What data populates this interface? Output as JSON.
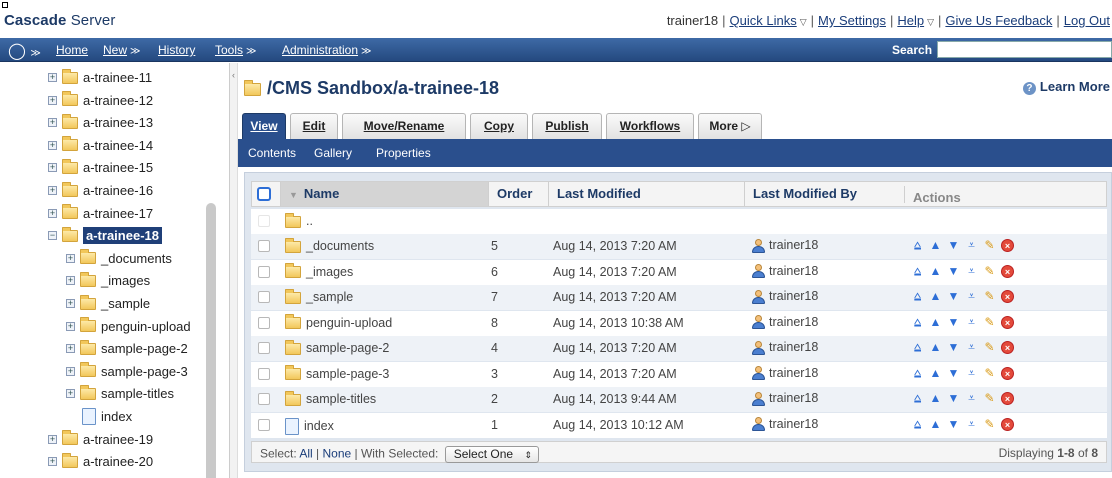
{
  "brand": {
    "name_bold": "Cascade",
    "name_rest": " Server"
  },
  "toplinks": {
    "user": "trainer18",
    "quick_links": "Quick Links",
    "my_settings": "My Settings",
    "help": "Help",
    "feedback": "Give Us Feedback",
    "logout": "Log Out"
  },
  "nav": {
    "items": [
      "Home",
      "New",
      "History",
      "Tools",
      "Administration"
    ],
    "search_label": "Search",
    "search_value": ""
  },
  "tree": [
    {
      "label": "a-trainee-11",
      "type": "folder",
      "expander": "+"
    },
    {
      "label": "a-trainee-12",
      "type": "folder",
      "expander": "+"
    },
    {
      "label": "a-trainee-13",
      "type": "folder",
      "expander": "+"
    },
    {
      "label": "a-trainee-14",
      "type": "folder",
      "expander": "+"
    },
    {
      "label": "a-trainee-15",
      "type": "folder",
      "expander": "+"
    },
    {
      "label": "a-trainee-16",
      "type": "folder",
      "expander": "+"
    },
    {
      "label": "a-trainee-17",
      "type": "folder",
      "expander": "+"
    },
    {
      "label": "a-trainee-18",
      "type": "folder",
      "expander": "−",
      "selected": true
    },
    {
      "label": "_documents",
      "type": "folder",
      "expander": "+"
    },
    {
      "label": "_images",
      "type": "folder",
      "expander": "+"
    },
    {
      "label": "_sample",
      "type": "folder",
      "expander": "+"
    },
    {
      "label": "penguin-upload",
      "type": "folder",
      "expander": "+"
    },
    {
      "label": "sample-page-2",
      "type": "folder",
      "expander": "+"
    },
    {
      "label": "sample-page-3",
      "type": "folder",
      "expander": "+"
    },
    {
      "label": "sample-titles",
      "type": "folder",
      "expander": "+"
    },
    {
      "label": "index",
      "type": "page",
      "expander": ""
    },
    {
      "label": "a-trainee-19",
      "type": "folder",
      "expander": "+"
    },
    {
      "label": "a-trainee-20",
      "type": "folder",
      "expander": "+"
    }
  ],
  "main": {
    "path_title": "/CMS Sandbox/a-trainee-18",
    "learn_more": "Learn More",
    "tabs": [
      "View",
      "Edit",
      "Move/Rename",
      "Copy",
      "Publish",
      "Workflows",
      "More ▷"
    ],
    "subtabs": [
      "Contents",
      "Gallery",
      "Properties"
    ]
  },
  "table": {
    "headers": {
      "name": "Name",
      "order": "Order",
      "modified": "Last Modified",
      "modified_by": "Last Modified By",
      "actions": "Actions"
    },
    "parent_row": "..",
    "rows": [
      {
        "name": "_documents",
        "type": "folder",
        "order": "5",
        "modified": "Aug 14, 2013 7:20 AM",
        "by": "trainer18"
      },
      {
        "name": "_images",
        "type": "folder",
        "order": "6",
        "modified": "Aug 14, 2013 7:20 AM",
        "by": "trainer18"
      },
      {
        "name": "_sample",
        "type": "folder",
        "order": "7",
        "modified": "Aug 14, 2013 7:20 AM",
        "by": "trainer18"
      },
      {
        "name": "penguin-upload",
        "type": "folder",
        "order": "8",
        "modified": "Aug 14, 2013 10:38 AM",
        "by": "trainer18"
      },
      {
        "name": "sample-page-2",
        "type": "folder",
        "order": "4",
        "modified": "Aug 14, 2013 7:20 AM",
        "by": "trainer18"
      },
      {
        "name": "sample-page-3",
        "type": "folder",
        "order": "3",
        "modified": "Aug 14, 2013 7:20 AM",
        "by": "trainer18"
      },
      {
        "name": "sample-titles",
        "type": "folder",
        "order": "2",
        "modified": "Aug 14, 2013 9:44 AM",
        "by": "trainer18"
      },
      {
        "name": "index",
        "type": "page",
        "order": "1",
        "modified": "Aug 14, 2013 10:12 AM",
        "by": "trainer18"
      }
    ],
    "footer": {
      "select_label": "Select:",
      "all": "All",
      "none": "None",
      "with_selected": "With Selected:",
      "select_one": "Select One",
      "displaying": "Displaying",
      "range": "1-8",
      "of": "of",
      "total": "8"
    }
  },
  "colors": {
    "nav": "#2a4f8d",
    "brand": "#1d3a66",
    "selected": "#1f3f78"
  }
}
